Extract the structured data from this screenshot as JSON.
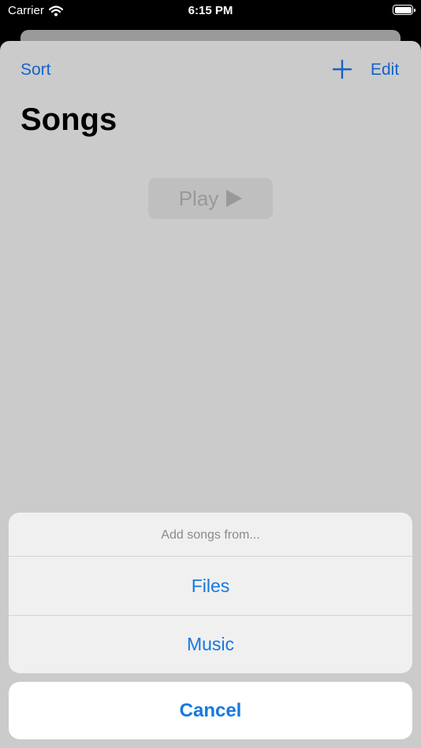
{
  "status_bar": {
    "carrier": "Carrier",
    "time": "6:15 PM"
  },
  "nav": {
    "sort_label": "Sort",
    "edit_label": "Edit",
    "add_icon": "plus-icon"
  },
  "page": {
    "title": "Songs",
    "play_label": "Play"
  },
  "action_sheet": {
    "title": "Add songs from...",
    "options": [
      {
        "label": "Files"
      },
      {
        "label": "Music"
      }
    ],
    "cancel_label": "Cancel"
  },
  "colors": {
    "accent": "#1678e0",
    "nav_tint": "#1563c9",
    "dimmed_background": "#cbcbcb"
  }
}
